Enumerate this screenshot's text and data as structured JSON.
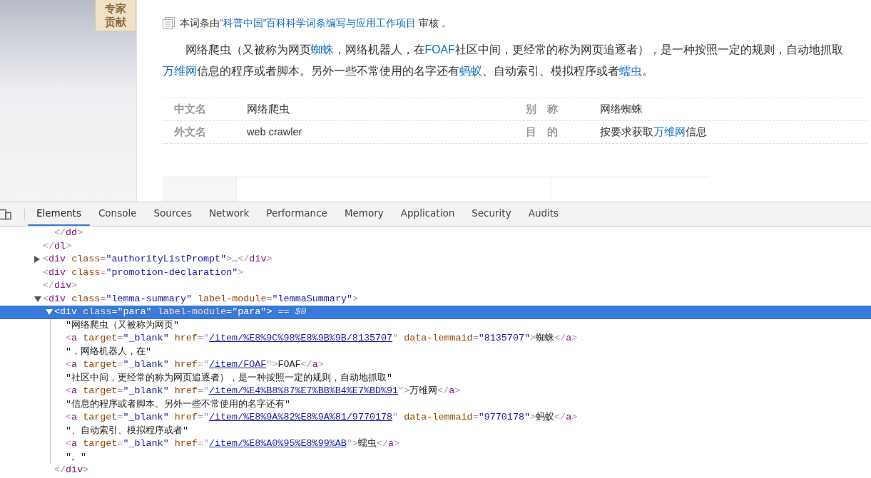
{
  "sidebar": {
    "badge_lines": [
      "专家",
      "贡献"
    ]
  },
  "review_note": {
    "segments": [
      {
        "text": "本词条由",
        "link": false
      },
      {
        "text": "“科普中国”百科科学词条编写与应用工作项目",
        "link": true
      },
      {
        "text": " 审核 。",
        "link": false
      }
    ]
  },
  "summary": {
    "segments": [
      {
        "text": "网络爬虫（又被称为网页",
        "link": false
      },
      {
        "text": "蜘蛛",
        "link": true
      },
      {
        "text": "，网络机器人，在",
        "link": false
      },
      {
        "text": "FOAF",
        "link": true
      },
      {
        "text": "社区中间，更经常的称为网页追逐者），是一种按照一定的规则，自动地抓取",
        "link": false
      },
      {
        "text": "万维网",
        "link": true
      },
      {
        "text": "信息的程序或者脚本。另外一些不常使用的名字还有",
        "link": false
      },
      {
        "text": "蚂蚁",
        "link": true
      },
      {
        "text": "、自动索引、模拟程序或者",
        "link": false
      },
      {
        "text": "蠕虫",
        "link": true
      },
      {
        "text": "。",
        "link": false
      }
    ]
  },
  "info_table": {
    "rows": [
      {
        "cells": [
          {
            "label": "中文名",
            "segments": [
              {
                "text": "网络爬虫",
                "link": false
              }
            ]
          },
          {
            "label": "别　称",
            "segments": [
              {
                "text": "网络蜘蛛",
                "link": false
              }
            ]
          }
        ]
      },
      {
        "cells": [
          {
            "label": "外文名",
            "segments": [
              {
                "text": "web crawler",
                "link": false
              }
            ]
          },
          {
            "label": "目　的",
            "segments": [
              {
                "text": "按要求获取",
                "link": false
              },
              {
                "text": "万维网",
                "link": true
              },
              {
                "text": "信息",
                "link": false
              }
            ]
          }
        ]
      }
    ]
  },
  "devtools": {
    "tabs": [
      {
        "label": "Elements",
        "selected": true
      },
      {
        "label": "Console",
        "selected": false
      },
      {
        "label": "Sources",
        "selected": false
      },
      {
        "label": "Network",
        "selected": false
      },
      {
        "label": "Performance",
        "selected": false
      },
      {
        "label": "Memory",
        "selected": false
      },
      {
        "label": "Application",
        "selected": false
      },
      {
        "label": "Security",
        "selected": false
      },
      {
        "label": "Audits",
        "selected": false
      }
    ],
    "dom_tree": [
      {
        "selected": false,
        "children": [
          {
            "selected": false,
            "tokens": [
              {
                "kind": "punct",
                "text": "</"
              },
              {
                "kind": "tag",
                "text": "dd"
              },
              {
                "kind": "punct",
                "text": ">"
              }
            ]
          }
        ],
        "closing": [
          {
            "kind": "punct",
            "text": "</"
          },
          {
            "kind": "tag",
            "text": "dl"
          },
          {
            "kind": "punct",
            "text": ">"
          }
        ]
      },
      {
        "selected": false,
        "expanded": false,
        "tokens": [
          {
            "kind": "punct",
            "text": "<"
          },
          {
            "kind": "tag",
            "text": "div"
          },
          {
            "kind": "attr",
            "text": " class"
          },
          {
            "kind": "punct",
            "text": "="
          },
          {
            "kind": "value",
            "text": "\"authorityListPrompt\""
          },
          {
            "kind": "punct",
            "text": ">"
          },
          {
            "kind": "text",
            "text": "…"
          },
          {
            "kind": "punct",
            "text": "</"
          },
          {
            "kind": "tag",
            "text": "div"
          },
          {
            "kind": "punct",
            "text": ">"
          }
        ]
      },
      {
        "selected": false,
        "tokens": [
          {
            "kind": "punct",
            "text": "<"
          },
          {
            "kind": "tag",
            "text": "div"
          },
          {
            "kind": "attr",
            "text": " class"
          },
          {
            "kind": "punct",
            "text": "="
          },
          {
            "kind": "value",
            "text": "\"promotion-declaration\""
          },
          {
            "kind": "punct",
            "text": ">"
          }
        ],
        "closing": [
          {
            "kind": "punct",
            "text": "</"
          },
          {
            "kind": "tag",
            "text": "div"
          },
          {
            "kind": "punct",
            "text": ">"
          }
        ]
      },
      {
        "selected": false,
        "expanded": true,
        "tokens": [
          {
            "kind": "punct",
            "text": "<"
          },
          {
            "kind": "tag",
            "text": "div"
          },
          {
            "kind": "attr",
            "text": " class"
          },
          {
            "kind": "punct",
            "text": "="
          },
          {
            "kind": "value",
            "text": "\"lemma-summary\""
          },
          {
            "kind": "attr",
            "text": " label-module"
          },
          {
            "kind": "punct",
            "text": "="
          },
          {
            "kind": "value",
            "text": "\"lemmaSummary\""
          },
          {
            "kind": "punct",
            "text": ">"
          }
        ],
        "children": [
          {
            "selected": true,
            "expanded": true,
            "tokens": [
              {
                "kind": "punct",
                "text": "<"
              },
              {
                "kind": "tag",
                "text": "div"
              },
              {
                "kind": "attr",
                "text": " class"
              },
              {
                "kind": "punct",
                "text": "="
              },
              {
                "kind": "value",
                "text": "\"para\""
              },
              {
                "kind": "attr",
                "text": " label-module"
              },
              {
                "kind": "punct",
                "text": "="
              },
              {
                "kind": "value",
                "text": "\"para\""
              },
              {
                "kind": "punct",
                "text": ">"
              },
              {
                "kind": "hint",
                "text": " == $0"
              }
            ],
            "children": [
              {
                "selected": false,
                "tokens": [
                  {
                    "kind": "text",
                    "text": "\"网络爬虫（又被称为网页\""
                  }
                ]
              },
              {
                "selected": false,
                "tokens": [
                  {
                    "kind": "punct",
                    "text": "<"
                  },
                  {
                    "kind": "tag",
                    "text": "a"
                  },
                  {
                    "kind": "attr",
                    "text": " target"
                  },
                  {
                    "kind": "punct",
                    "text": "="
                  },
                  {
                    "kind": "value",
                    "text": "\"_blank\""
                  },
                  {
                    "kind": "attr",
                    "text": " href"
                  },
                  {
                    "kind": "punct",
                    "text": "=\""
                  },
                  {
                    "kind": "link",
                    "text": "/item/%E8%9C%98%E8%9B%9B/8135707"
                  },
                  {
                    "kind": "punct",
                    "text": "\""
                  },
                  {
                    "kind": "attr",
                    "text": " data-lemmaid"
                  },
                  {
                    "kind": "punct",
                    "text": "="
                  },
                  {
                    "kind": "value",
                    "text": "\"8135707\""
                  },
                  {
                    "kind": "punct",
                    "text": ">"
                  },
                  {
                    "kind": "text",
                    "text": "蜘蛛"
                  },
                  {
                    "kind": "punct",
                    "text": "</"
                  },
                  {
                    "kind": "tag",
                    "text": "a"
                  },
                  {
                    "kind": "punct",
                    "text": ">"
                  }
                ]
              },
              {
                "selected": false,
                "tokens": [
                  {
                    "kind": "text",
                    "text": "\"，网络机器人，在\""
                  }
                ]
              },
              {
                "selected": false,
                "tokens": [
                  {
                    "kind": "punct",
                    "text": "<"
                  },
                  {
                    "kind": "tag",
                    "text": "a"
                  },
                  {
                    "kind": "attr",
                    "text": " target"
                  },
                  {
                    "kind": "punct",
                    "text": "="
                  },
                  {
                    "kind": "value",
                    "text": "\"_blank\""
                  },
                  {
                    "kind": "attr",
                    "text": " href"
                  },
                  {
                    "kind": "punct",
                    "text": "=\""
                  },
                  {
                    "kind": "link",
                    "text": "/item/FOAF"
                  },
                  {
                    "kind": "punct",
                    "text": "\">"
                  },
                  {
                    "kind": "text",
                    "text": "FOAF"
                  },
                  {
                    "kind": "punct",
                    "text": "</"
                  },
                  {
                    "kind": "tag",
                    "text": "a"
                  },
                  {
                    "kind": "punct",
                    "text": ">"
                  }
                ]
              },
              {
                "selected": false,
                "tokens": [
                  {
                    "kind": "text",
                    "text": "\"社区中间，更经常的称为网页追逐者），是一种按照一定的规则，自动地抓取\""
                  }
                ]
              },
              {
                "selected": false,
                "tokens": [
                  {
                    "kind": "punct",
                    "text": "<"
                  },
                  {
                    "kind": "tag",
                    "text": "a"
                  },
                  {
                    "kind": "attr",
                    "text": " target"
                  },
                  {
                    "kind": "punct",
                    "text": "="
                  },
                  {
                    "kind": "value",
                    "text": "\"_blank\""
                  },
                  {
                    "kind": "attr",
                    "text": " href"
                  },
                  {
                    "kind": "punct",
                    "text": "=\""
                  },
                  {
                    "kind": "link",
                    "text": "/item/%E4%B8%87%E7%BB%B4%E7%BD%91"
                  },
                  {
                    "kind": "punct",
                    "text": "\">"
                  },
                  {
                    "kind": "text",
                    "text": "万维网"
                  },
                  {
                    "kind": "punct",
                    "text": "</"
                  },
                  {
                    "kind": "tag",
                    "text": "a"
                  },
                  {
                    "kind": "punct",
                    "text": ">"
                  }
                ]
              },
              {
                "selected": false,
                "tokens": [
                  {
                    "kind": "text",
                    "text": "\"信息的程序或者脚本。另外一些不常使用的名字还有\""
                  }
                ]
              },
              {
                "selected": false,
                "tokens": [
                  {
                    "kind": "punct",
                    "text": "<"
                  },
                  {
                    "kind": "tag",
                    "text": "a"
                  },
                  {
                    "kind": "attr",
                    "text": " target"
                  },
                  {
                    "kind": "punct",
                    "text": "="
                  },
                  {
                    "kind": "value",
                    "text": "\"_blank\""
                  },
                  {
                    "kind": "attr",
                    "text": " href"
                  },
                  {
                    "kind": "punct",
                    "text": "=\""
                  },
                  {
                    "kind": "link",
                    "text": "/item/%E8%9A%82%E8%9A%81/9770178"
                  },
                  {
                    "kind": "punct",
                    "text": "\""
                  },
                  {
                    "kind": "attr",
                    "text": " data-lemmaid"
                  },
                  {
                    "kind": "punct",
                    "text": "="
                  },
                  {
                    "kind": "value",
                    "text": "\"9770178\""
                  },
                  {
                    "kind": "punct",
                    "text": ">"
                  },
                  {
                    "kind": "text",
                    "text": "蚂蚁"
                  },
                  {
                    "kind": "punct",
                    "text": "</"
                  },
                  {
                    "kind": "tag",
                    "text": "a"
                  },
                  {
                    "kind": "punct",
                    "text": ">"
                  }
                ]
              },
              {
                "selected": false,
                "tokens": [
                  {
                    "kind": "text",
                    "text": "\"、自动索引、模拟程序或者\""
                  }
                ]
              },
              {
                "selected": false,
                "tokens": [
                  {
                    "kind": "punct",
                    "text": "<"
                  },
                  {
                    "kind": "tag",
                    "text": "a"
                  },
                  {
                    "kind": "attr",
                    "text": " target"
                  },
                  {
                    "kind": "punct",
                    "text": "="
                  },
                  {
                    "kind": "value",
                    "text": "\"_blank\""
                  },
                  {
                    "kind": "attr",
                    "text": " href"
                  },
                  {
                    "kind": "punct",
                    "text": "=\""
                  },
                  {
                    "kind": "link",
                    "text": "/item/%E8%A0%95%E8%99%AB"
                  },
                  {
                    "kind": "punct",
                    "text": "\">"
                  },
                  {
                    "kind": "text",
                    "text": "蠕虫"
                  },
                  {
                    "kind": "punct",
                    "text": "</"
                  },
                  {
                    "kind": "tag",
                    "text": "a"
                  },
                  {
                    "kind": "punct",
                    "text": ">"
                  }
                ]
              },
              {
                "selected": false,
                "tokens": [
                  {
                    "kind": "text",
                    "text": "\"。\""
                  }
                ]
              }
            ],
            "closing": [
              {
                "kind": "punct",
                "text": "</"
              },
              {
                "kind": "tag",
                "text": "div"
              },
              {
                "kind": "punct",
                "text": ">"
              }
            ]
          }
        ]
      }
    ]
  }
}
